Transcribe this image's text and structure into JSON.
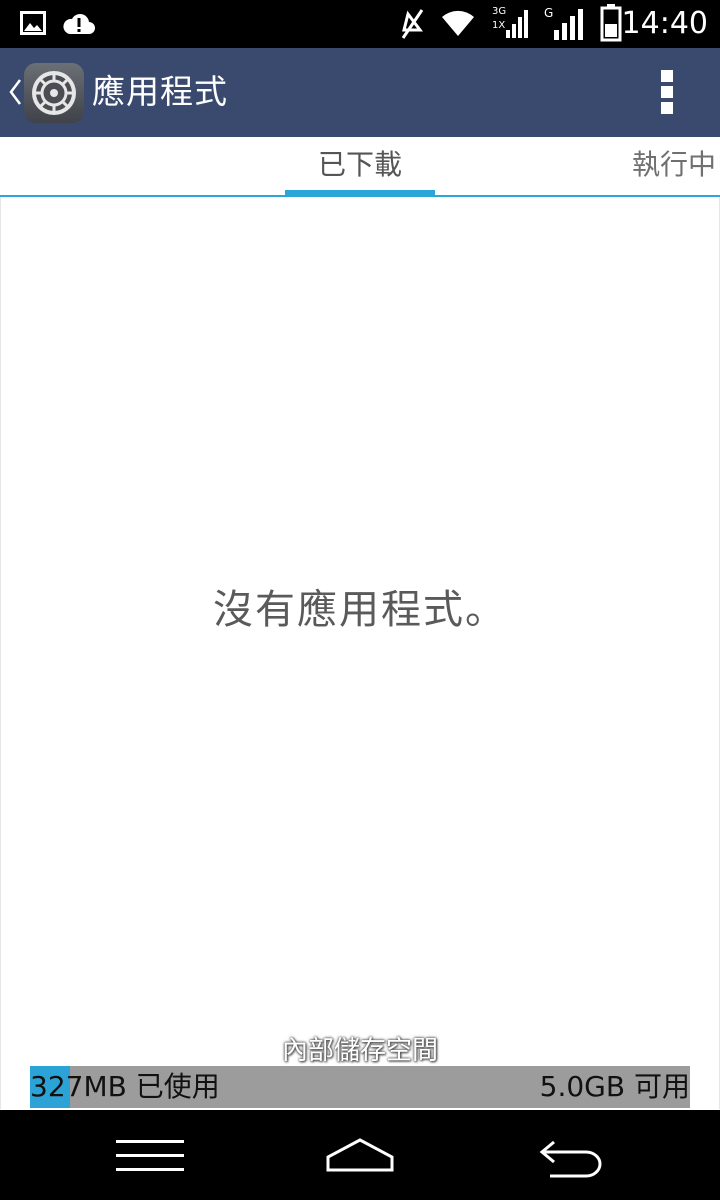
{
  "status_bar": {
    "time": "14:40",
    "network_3g": "3G",
    "network_1x": "1X",
    "network_g": "G",
    "icons": [
      "gallery-icon",
      "cloud-alert-icon",
      "mute-icon",
      "wifi-icon",
      "signal-3g-icon",
      "signal-g-icon",
      "battery-icon"
    ]
  },
  "action_bar": {
    "title": "應用程式",
    "icon": "settings-gear-icon"
  },
  "tabs": [
    {
      "label": "已下載",
      "active": true
    },
    {
      "label": "執行中",
      "active": false
    }
  ],
  "content": {
    "empty_message": "沒有應用程式。"
  },
  "storage": {
    "label": "內部儲存空間",
    "used_text": "327MB 已使用",
    "free_text": "5.0GB 可用",
    "used_fraction": 0.06,
    "used_color": "#2ba3d6",
    "bar_color": "#9c9c9c"
  },
  "nav_bar": {
    "buttons": [
      "menu-icon",
      "home-icon",
      "back-icon"
    ]
  },
  "colors": {
    "action_bar": "#3a4a6e",
    "accent": "#2aa7d8"
  }
}
